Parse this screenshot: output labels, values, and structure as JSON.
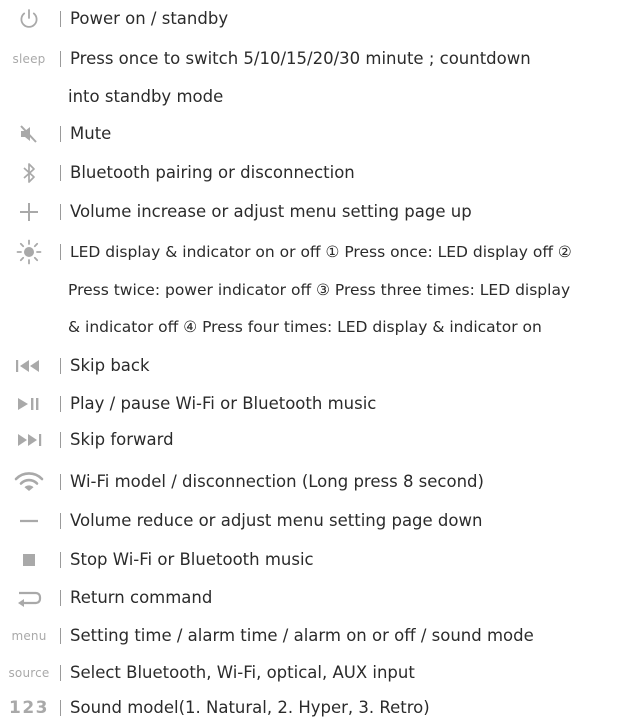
{
  "rows": [
    {
      "icon": "power-icon",
      "text": "Power on / standby"
    },
    {
      "icon": "sleep-label",
      "icon_text": "sleep",
      "text": "Press once to switch 5/10/15/20/30 minute ; countdown",
      "cont": [
        "into standby mode"
      ]
    },
    {
      "icon": "mute-icon",
      "text": "Mute"
    },
    {
      "icon": "bluetooth-icon",
      "text": "Bluetooth pairing or disconnection"
    },
    {
      "icon": "plus-icon",
      "text": "Volume increase or adjust menu setting page up"
    },
    {
      "icon": "led-sun-icon",
      "text": "LED display & indicator on or off ① Press once: LED display off ②",
      "cont": [
        "Press twice: power indicator off ③ Press three times: LED display",
        "& indicator off ④ Press four times: LED display & indicator on"
      ]
    },
    {
      "icon": "skip-back-icon",
      "text": "Skip back"
    },
    {
      "icon": "play-pause-icon",
      "text": "Play / pause Wi-Fi or Bluetooth music"
    },
    {
      "icon": "skip-forward-icon",
      "text": "Skip forward"
    },
    {
      "icon": "wifi-icon",
      "text": "Wi-Fi model / disconnection (Long press 8 second)"
    },
    {
      "icon": "minus-icon",
      "text": "Volume reduce or adjust menu setting page down"
    },
    {
      "icon": "stop-icon",
      "text": "Stop Wi-Fi or Bluetooth music"
    },
    {
      "icon": "return-icon",
      "text": "Return command"
    },
    {
      "icon": "menu-label",
      "icon_text": "menu",
      "text": "Setting time / alarm time / alarm on or off / sound mode"
    },
    {
      "icon": "source-label",
      "icon_text": "source",
      "text": "Select Bluetooth, Wi-Fi, optical, AUX input"
    },
    {
      "icon": "sound-model-123-label",
      "icon_text": "123",
      "text": "Sound model(1. Natural, 2. Hyper, 3. Retro)"
    }
  ],
  "colors": {
    "icon": "#a9a9a9",
    "text": "#2b2b2b",
    "separator": "#9a9a9a"
  }
}
